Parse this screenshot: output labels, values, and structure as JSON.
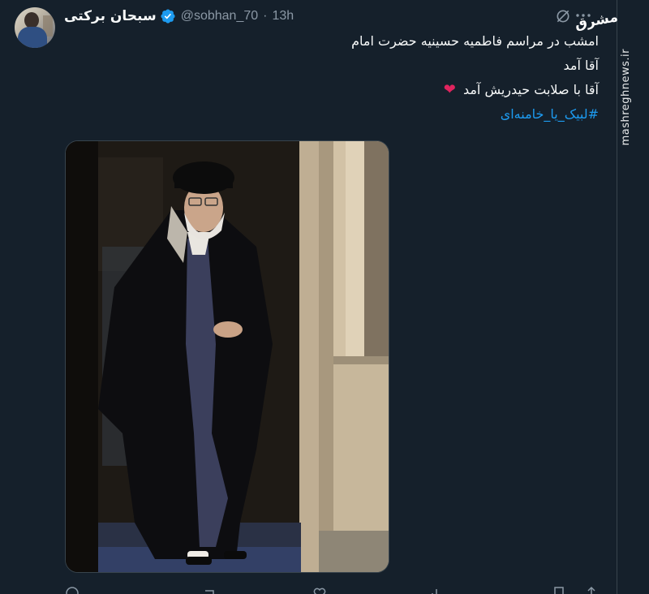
{
  "author": {
    "display_name": "سبحان برکتی",
    "handle": "@sobhan_70",
    "separator": "·",
    "time": "13h",
    "verified": true
  },
  "tweet": {
    "line1": "امشب در مراسم فاطمیه حسینیه حضرت امام",
    "line2": "آقا آمد",
    "line3": "آقا با صلابت حیدریش آمد",
    "line3_emoji": "❤",
    "hashtag": "#لبیک_یا_خامنه‌ای"
  },
  "icons": {
    "grok": "grok-icon",
    "more": "more-icon",
    "verified": "verified-badge-icon",
    "actions": [
      "reply-icon",
      "retweet-icon",
      "like-icon",
      "views-icon",
      "bookmark-icon",
      "share-icon"
    ]
  },
  "watermark": {
    "logo": "مشرق",
    "site": "mashreghnews.ir"
  },
  "colors": {
    "background": "#15202b",
    "accent": "#1d9bf0",
    "text_primary": "#f7f9f9",
    "text_secondary": "#8b98a5",
    "heart": "#e0245e"
  }
}
